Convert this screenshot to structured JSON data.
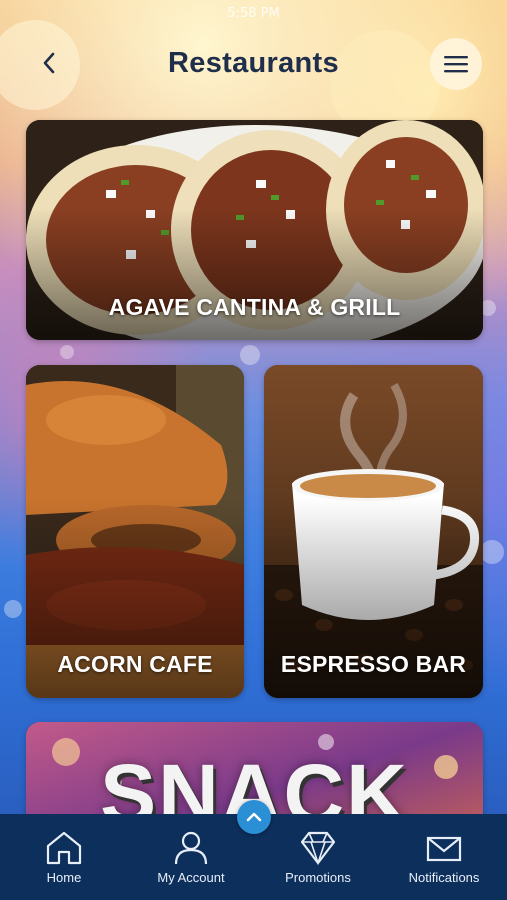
{
  "status": {
    "time": "5:58 PM",
    "right": "◂ ▭"
  },
  "header": {
    "title": "Restaurants"
  },
  "cards": [
    {
      "label": "AGAVE CANTINA & GRILL"
    },
    {
      "label": "ACORN CAFE"
    },
    {
      "label": "ESPRESSO BAR"
    },
    {
      "label": "SNACK"
    }
  ],
  "tabs": [
    {
      "label": "Home",
      "icon": "home-icon"
    },
    {
      "label": "My Account",
      "icon": "person-icon"
    },
    {
      "label": "Promotions",
      "icon": "diamond-icon"
    },
    {
      "label": "Notifications",
      "icon": "envelope-icon"
    }
  ],
  "colors": {
    "tabbar": "#0c2f5c",
    "title": "#1f2e4a",
    "accent": "#2b8fd6"
  }
}
